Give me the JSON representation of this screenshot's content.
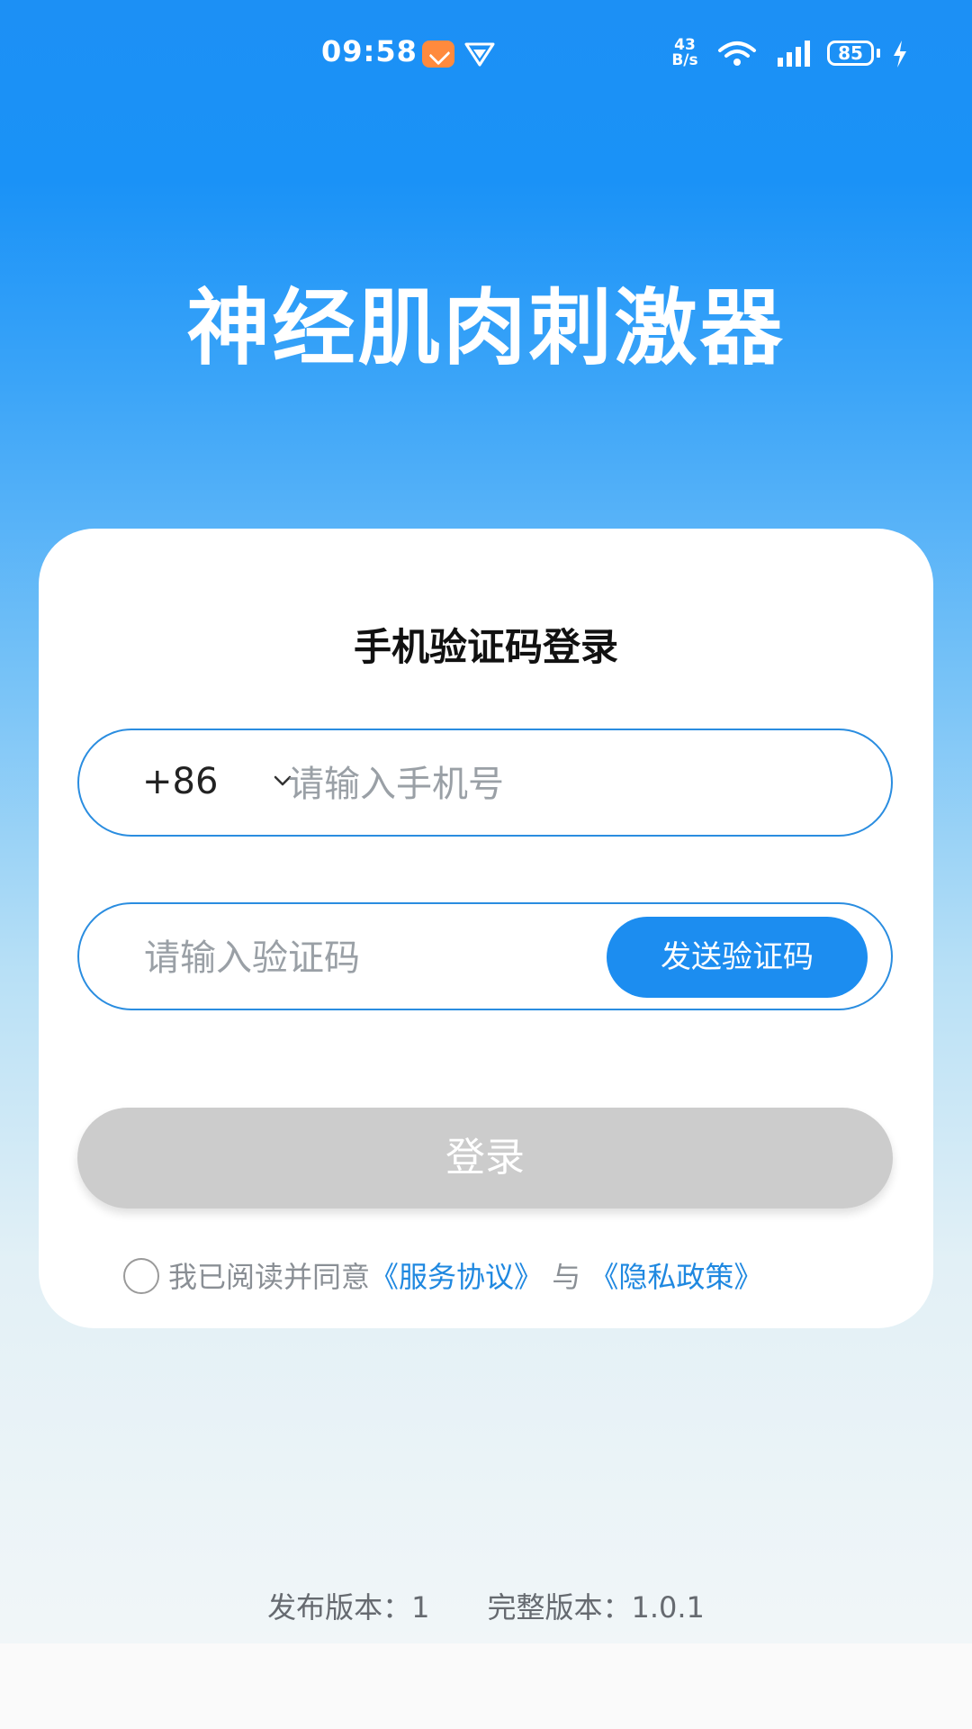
{
  "status_bar": {
    "time": "09:58",
    "net_speed_value": "43",
    "net_speed_unit": "B/s",
    "battery": "85",
    "icons": [
      "app-notification-icon",
      "vpn-icon",
      "wifi-icon",
      "signal-5g-icon",
      "battery-icon",
      "charging-icon"
    ]
  },
  "app": {
    "title": "神经肌肉刺激器"
  },
  "login": {
    "title": "手机验证码登录",
    "country_code": "+86",
    "phone_placeholder": "请输入手机号",
    "code_placeholder": "请输入验证码",
    "send_code_label": "发送验证码",
    "login_label": "登录",
    "agreement_prefix": "我已阅读并同意",
    "service_link": "《服务协议》",
    "conjunction": "与",
    "privacy_link": "《隐私政策》"
  },
  "footer": {
    "release_version": "发布版本：1",
    "full_version": "完整版本：1.0.1"
  },
  "colors": {
    "accent": "#1c8df0",
    "disabled": "#cccccc",
    "link": "#1f88e0"
  }
}
